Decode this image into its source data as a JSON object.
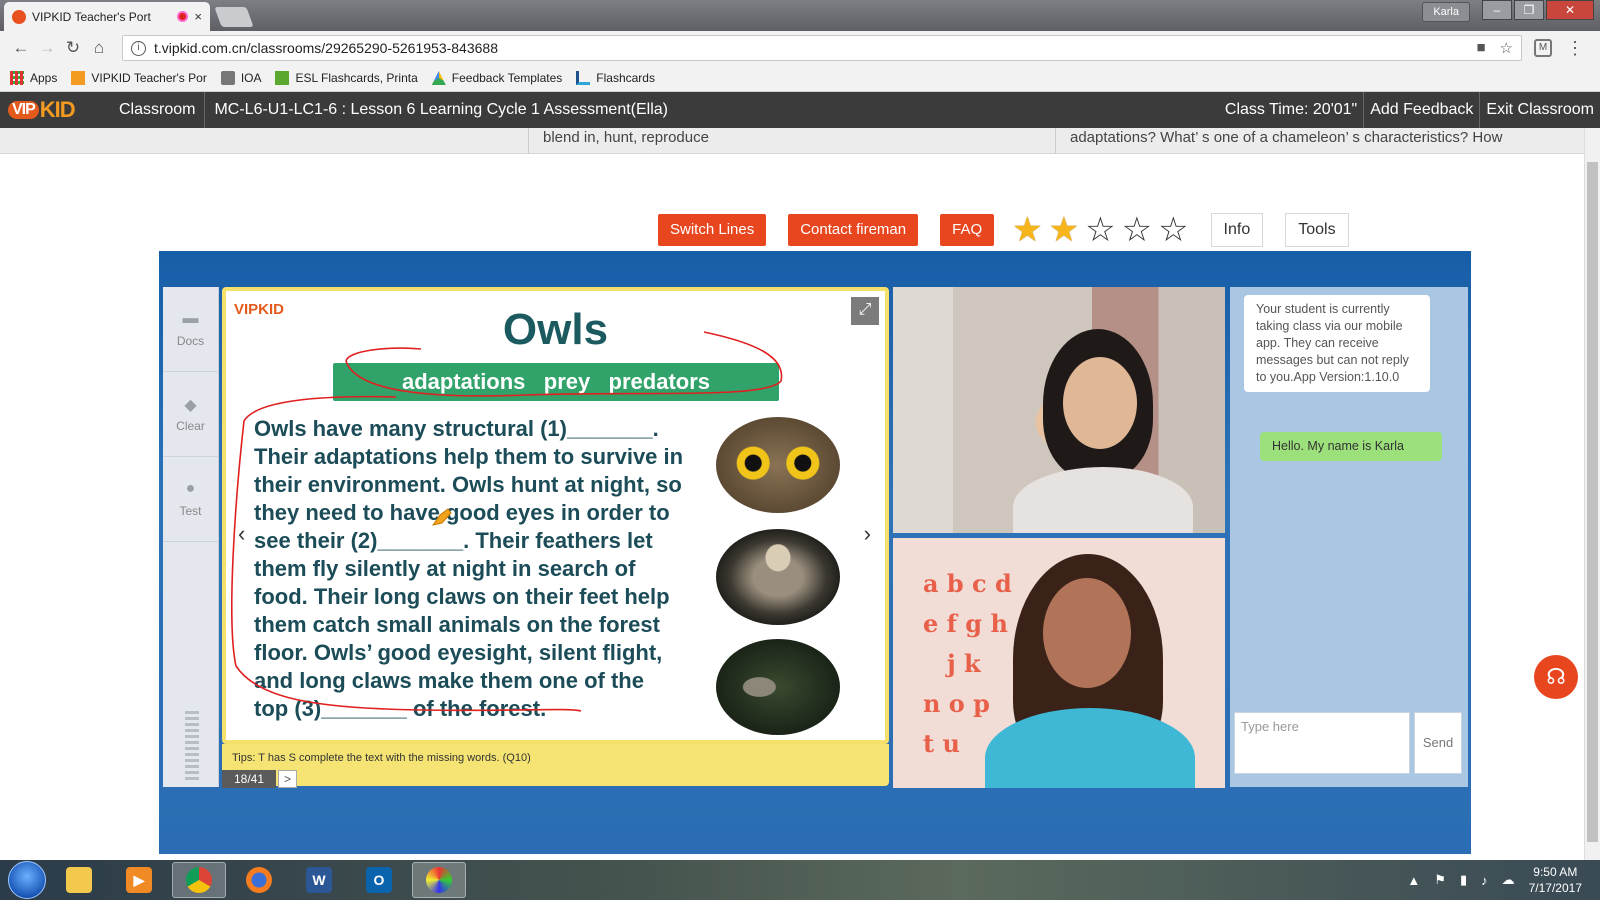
{
  "browser": {
    "tab_title": "VIPKID Teacher's Port",
    "close_glyph": "×",
    "profile": "Karla",
    "url": "t.vipkid.com.cn/classrooms/29265290-5261953-843688",
    "bookmarks": [
      {
        "label": "Apps"
      },
      {
        "label": "VIPKID Teacher's Por"
      },
      {
        "label": "IOA"
      },
      {
        "label": "ESL Flashcards, Printa"
      },
      {
        "label": "Feedback Templates"
      },
      {
        "label": "Flashcards"
      }
    ]
  },
  "header": {
    "logo": "VIP KID",
    "classroom": "Classroom",
    "lesson_title": "MC-L6-U1-LC1-6 : Lesson 6 Learning Cycle 1 Assessment(Ella)",
    "class_time": "Class Time: 20'01\"",
    "add_feedback": "Add Feedback",
    "exit_classroom": "Exit Classroom"
  },
  "lesson_strip": {
    "col1": "blend in, hunt, reproduce",
    "col2": "adaptations? What’ s one of a chameleon’ s characteristics? How"
  },
  "actions": {
    "switch_lines": "Switch Lines",
    "contact_fireman": "Contact fireman",
    "faq": "FAQ",
    "rating": 2,
    "rating_max": 5,
    "info": "Info",
    "tools": "Tools"
  },
  "left_tools": [
    {
      "label": "Docs"
    },
    {
      "label": "Clear"
    },
    {
      "label": "Test"
    }
  ],
  "slide": {
    "logo": "VIPKID",
    "title": "Owls",
    "vocab": "adaptations   prey   predators",
    "passage": [
      "Owls have many structural (1)_______.",
      "Their adaptations help them to survive in",
      "their environment. Owls hunt at night, so",
      "they need to have good eyes in order to",
      "see their (2)_______.  Their feathers let",
      "them fly silently at night in search of",
      "food. Their long claws on their feet help",
      "them catch small animals on the forest",
      "floor. Owls’ good eyesight, silent flight,",
      "and long claws make them one of the",
      "top (3)_______ of the forest."
    ],
    "tips": "Tips: T has S complete the text with the missing words. (Q10)",
    "page": "18/41",
    "next": ">"
  },
  "video": {
    "teacher_letters": [
      "a b c d",
      "e f g h",
      "j k",
      "n o p",
      "t u"
    ]
  },
  "chat": {
    "system_message": "Your student is currently taking class via our mobile app. They can receive messages but can not reply to you.App Version:1.10.0",
    "my_message": "Hello. My name is Karla",
    "input_placeholder": "Type here",
    "send": "Send"
  },
  "taskbar": {
    "time": "9:50 AM",
    "date": "7/17/2017"
  }
}
